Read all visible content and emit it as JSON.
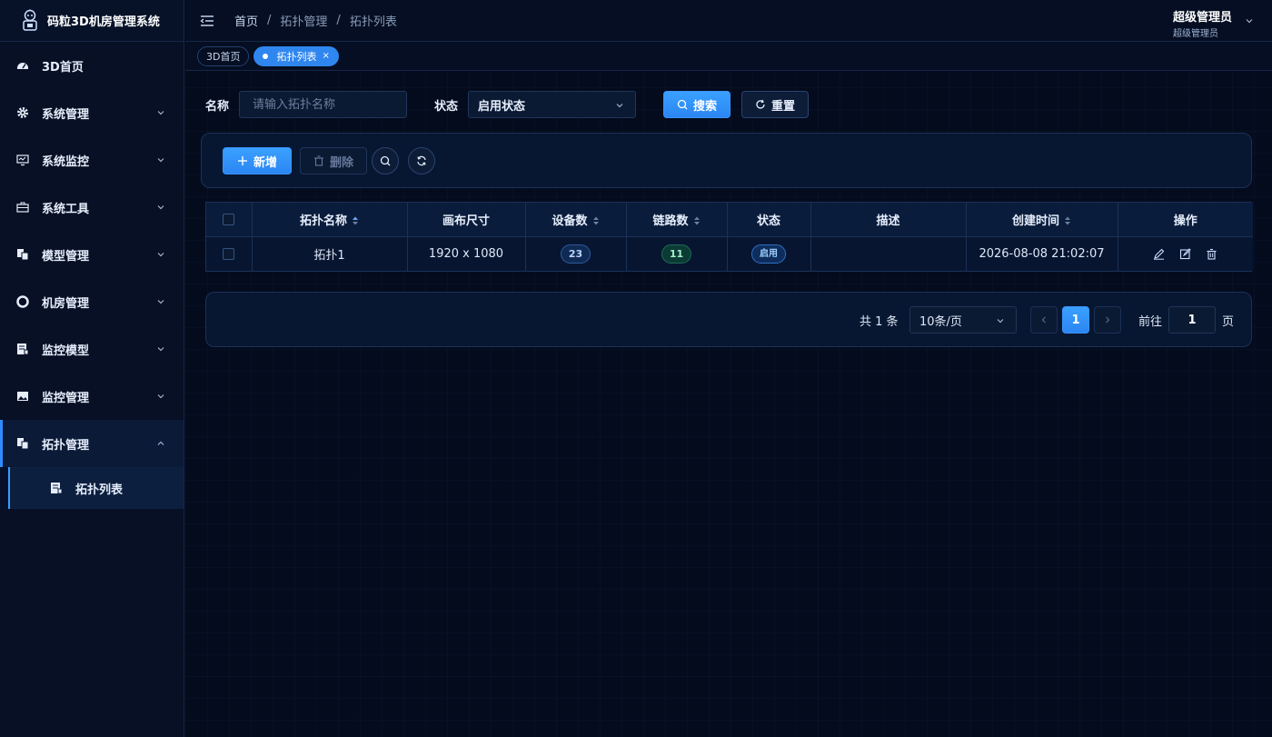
{
  "app": {
    "title": "码粒3D机房管理系统"
  },
  "sidebar": {
    "items": [
      {
        "label": "3D首页",
        "icon": "dashboard-icon"
      },
      {
        "label": "系统管理",
        "icon": "gear-icon"
      },
      {
        "label": "系统监控",
        "icon": "monitor-icon"
      },
      {
        "label": "系统工具",
        "icon": "toolbox-icon"
      },
      {
        "label": "模型管理",
        "icon": "copy-icon"
      },
      {
        "label": "机房管理",
        "icon": "lifebuoy-icon"
      },
      {
        "label": "监控模型",
        "icon": "server-icon"
      },
      {
        "label": "监控管理",
        "icon": "image-icon"
      },
      {
        "label": "拓扑管理",
        "icon": "copy-icon"
      }
    ],
    "sub_item": {
      "label": "拓扑列表",
      "icon": "server-icon"
    }
  },
  "header": {
    "breadcrumb": [
      "首页",
      "拓扑管理",
      "拓扑列表"
    ],
    "separator": "/",
    "user_name": "超级管理员",
    "user_role": "超级管理员"
  },
  "tabs": [
    {
      "label": "3D首页"
    },
    {
      "label": "拓扑列表",
      "close": "×"
    }
  ],
  "search": {
    "name_label": "名称",
    "name_placeholder": "请输入拓扑名称",
    "status_label": "状态",
    "status_value": "启用状态",
    "search_label": "搜索",
    "reset_label": "重置"
  },
  "toolbar": {
    "add_label": "新增",
    "delete_label": "删除"
  },
  "table": {
    "headers": [
      "拓扑名称",
      "画布尺寸",
      "设备数",
      "链路数",
      "状态",
      "描述",
      "创建时间",
      "操作"
    ],
    "rows": [
      {
        "name": "拓扑1",
        "size": "1920 x 1080",
        "devices": "23",
        "links": "11",
        "status": "启用",
        "desc": "",
        "created": "2026-08-08 21:02:07"
      }
    ]
  },
  "pagination": {
    "total": "共 1 条",
    "page_size": "10条/页",
    "current": "1",
    "goto_label": "前往",
    "goto_value": "1",
    "unit": "页"
  },
  "colors": {
    "accent": "#2f86ef",
    "bg": "#040b1d",
    "sidebar": "#071024"
  }
}
